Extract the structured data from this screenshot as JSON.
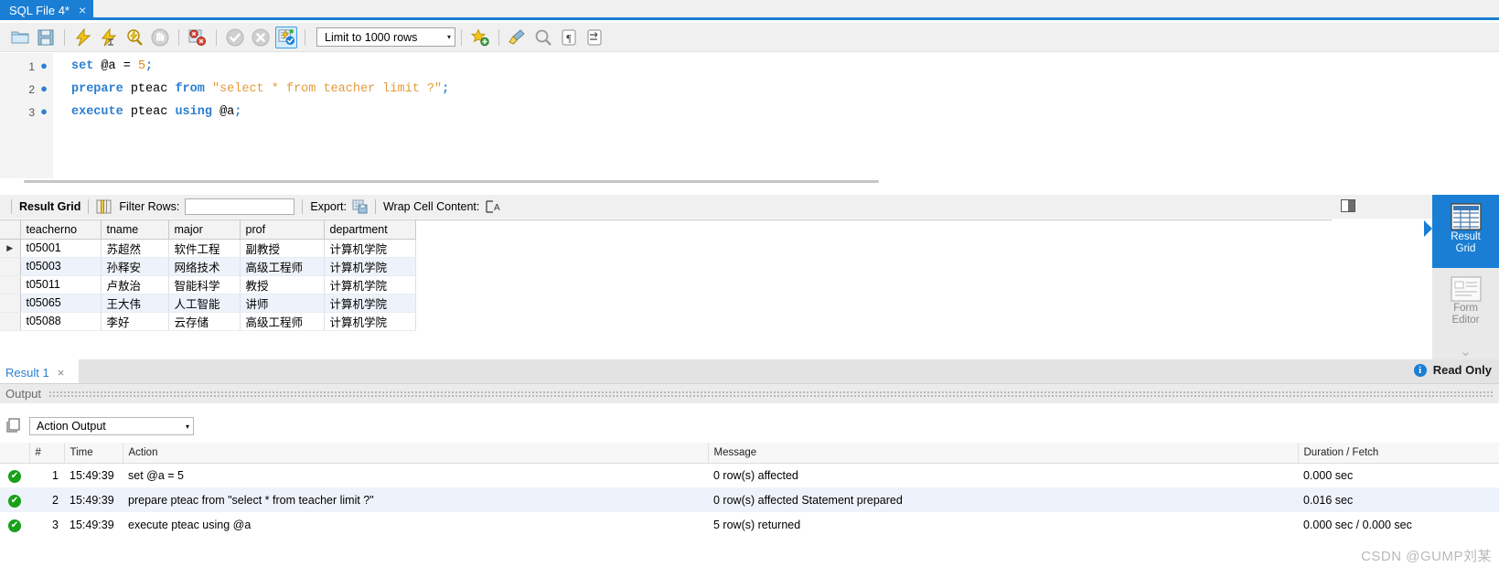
{
  "tab": {
    "title": "SQL File 4*",
    "close": "×"
  },
  "toolbar": {
    "buttons": [
      {
        "name": "open-sql-script",
        "icon": "folder-icon"
      },
      {
        "name": "save-sql-script",
        "icon": "save-icon"
      },
      {
        "name": "execute-statement",
        "icon": "lightning-bolt-icon"
      },
      {
        "name": "execute-current-statement",
        "icon": "lightning-cursor-icon"
      },
      {
        "name": "explain-statement",
        "icon": "magnifier-lightning-icon"
      },
      {
        "name": "stop-execution",
        "icon": "stop-hand-icon"
      },
      {
        "name": "toggle-stop-on-error",
        "icon": "stop-on-error-icon"
      },
      {
        "name": "commit-transaction",
        "icon": "check-circle-icon"
      },
      {
        "name": "rollback-transaction",
        "icon": "cancel-circle-icon"
      },
      {
        "name": "toggle-auto-commit",
        "icon": "autocommit-icon"
      }
    ],
    "limit_label": "Limit to 1000 rows",
    "limit_caret": "▾",
    "right_buttons": [
      {
        "name": "add-snippet",
        "icon": "star-plus-icon"
      },
      {
        "name": "beautify-query",
        "icon": "broom-icon"
      },
      {
        "name": "find-panel",
        "icon": "magnifier-icon"
      },
      {
        "name": "toggle-invisible-chars",
        "icon": "pilcrow-icon"
      },
      {
        "name": "toggle-word-wrap",
        "icon": "wrap-arrow-icon"
      }
    ]
  },
  "editor": {
    "lines": [
      {
        "number": "1",
        "marker": "●",
        "tokens": [
          {
            "t": "set",
            "c": "kw"
          },
          {
            "t": " ",
            "c": "idn"
          },
          {
            "t": "@a",
            "c": "var"
          },
          {
            "t": " = ",
            "c": "idn"
          },
          {
            "t": "5",
            "c": "num"
          },
          {
            "t": ";",
            "c": "pun"
          }
        ]
      },
      {
        "number": "2",
        "marker": "●",
        "tokens": [
          {
            "t": "prepare",
            "c": "kw"
          },
          {
            "t": " pteac ",
            "c": "idn"
          },
          {
            "t": "from",
            "c": "kw"
          },
          {
            "t": " ",
            "c": "idn"
          },
          {
            "t": "\"select * from teacher limit ?\"",
            "c": "str"
          },
          {
            "t": ";",
            "c": "pun"
          }
        ]
      },
      {
        "number": "3",
        "marker": "●",
        "tokens": [
          {
            "t": "execute",
            "c": "kw"
          },
          {
            "t": " pteac ",
            "c": "idn"
          },
          {
            "t": "using",
            "c": "kw"
          },
          {
            "t": " ",
            "c": "idn"
          },
          {
            "t": "@a",
            "c": "var"
          },
          {
            "t": ";",
            "c": "pun"
          }
        ]
      }
    ]
  },
  "result_toolbar": {
    "title": "Result Grid",
    "grid_icon": "grid-columns-icon",
    "filter_label": "Filter Rows:",
    "filter_value": "",
    "filter_placeholder": "",
    "export_label": "Export:",
    "export_icon": "export-grid-icon",
    "wrap_label": "Wrap Cell Content:",
    "wrap_icon": "wrap-cell-icon"
  },
  "grid": {
    "columns": [
      "teacherno",
      "tname",
      "major",
      "prof",
      "department"
    ],
    "row_marker": "▶",
    "rows": [
      {
        "selected": true,
        "cells": [
          "t05001",
          "苏超然",
          "软件工程",
          "副教授",
          "计算机学院"
        ]
      },
      {
        "selected": false,
        "cells": [
          "t05003",
          "孙释安",
          "网络技术",
          "高级工程师",
          "计算机学院"
        ]
      },
      {
        "selected": false,
        "cells": [
          "t05011",
          "卢敖治",
          "智能科学",
          "教授",
          "计算机学院"
        ]
      },
      {
        "selected": false,
        "cells": [
          "t05065",
          "王大伟",
          "人工智能",
          "讲师",
          "计算机学院"
        ]
      },
      {
        "selected": false,
        "cells": [
          "t05088",
          "李好",
          "云存储",
          "高级工程师",
          "计算机学院"
        ]
      }
    ]
  },
  "sidebox": {
    "items": [
      {
        "label_line1": "Result",
        "label_line2": "Grid",
        "icon": "result-grid-icon",
        "active": true
      },
      {
        "label_line1": "Form",
        "label_line2": "Editor",
        "icon": "form-editor-icon",
        "active": false
      }
    ],
    "more_chevron": "⌄"
  },
  "result_tab": {
    "label": "Result 1",
    "close": "×"
  },
  "read_only": {
    "label": "Read Only",
    "icon": "info-icon",
    "icon_glyph": "i"
  },
  "output": {
    "section_label": "Output",
    "panel_icon": "output-panel-icon",
    "selector_value": "Action Output",
    "selector_caret": "▾",
    "columns": [
      "",
      "#",
      "Time",
      "Action",
      "Message",
      "Duration / Fetch"
    ],
    "rows": [
      {
        "status": "success",
        "status_glyph": "✔",
        "num": "1",
        "time": "15:49:39",
        "action": "set @a = 5",
        "message": "0 row(s) affected",
        "duration": "0.000 sec"
      },
      {
        "status": "success",
        "status_glyph": "✔",
        "num": "2",
        "time": "15:49:39",
        "action": "prepare pteac from \"select * from teacher limit ?\"",
        "message": "0 row(s) affected Statement prepared",
        "duration": "0.016 sec"
      },
      {
        "status": "success",
        "status_glyph": "✔",
        "num": "3",
        "time": "15:49:39",
        "action": "execute pteac using @a",
        "message": "5 row(s) returned",
        "duration": "0.000 sec / 0.000 sec"
      }
    ]
  },
  "watermark": {
    "text": "CSDN @GUMP刘某"
  },
  "colors": {
    "accent": "#1a7fd4",
    "success": "#18a019",
    "keyword": "#2b7fd1",
    "string": "#e49b3c"
  }
}
